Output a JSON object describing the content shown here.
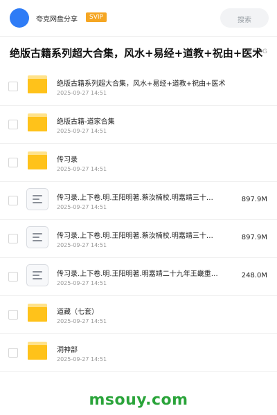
{
  "header": {
    "username": "夸克网盘分享",
    "badge": "SVIP",
    "search_placeholder": "搜索"
  },
  "share": {
    "title": "绝版古籍系列超大合集，风水+易经+道教+祝由+医术",
    "total_size": "5.0G"
  },
  "files": [
    {
      "type": "folder",
      "name": "绝版古籍系列超大合集，风水+易经+道教+祝由+医术",
      "date": "2025-09-27 14:51",
      "size": ""
    },
    {
      "type": "folder",
      "name": "绝版古籍-道家合集",
      "date": "2025-09-27 14:51",
      "size": ""
    },
    {
      "type": "folder",
      "name": "传习录",
      "date": "2025-09-27 14:51",
      "size": ""
    },
    {
      "type": "file",
      "name": "传习录.上下卷.明.王阳明著.蔡汝楠校.明嘉靖三十…",
      "date": "2025-09-27 14:51",
      "size": "897.9M"
    },
    {
      "type": "file",
      "name": "传习录.上下卷.明.王阳明著.蔡汝楠校.明嘉靖三十…",
      "date": "2025-09-27 14:51",
      "size": "897.9M"
    },
    {
      "type": "file",
      "name": "传习录.上下卷.明.王阳明著.明嘉靖二十九年王畿重…",
      "date": "2025-09-27 14:51",
      "size": "248.0M"
    },
    {
      "type": "folder",
      "name": "道藏（七套）",
      "date": "2025-09-27 14:51",
      "size": ""
    },
    {
      "type": "folder",
      "name": "洞神部",
      "date": "2025-09-27 14:51",
      "size": ""
    }
  ],
  "watermark": "msouy.com",
  "colors": {
    "avatar": "#2f7cf6",
    "badge": "#f5a623",
    "folder": "#ffc21a",
    "watermark": "#2aa43a"
  }
}
